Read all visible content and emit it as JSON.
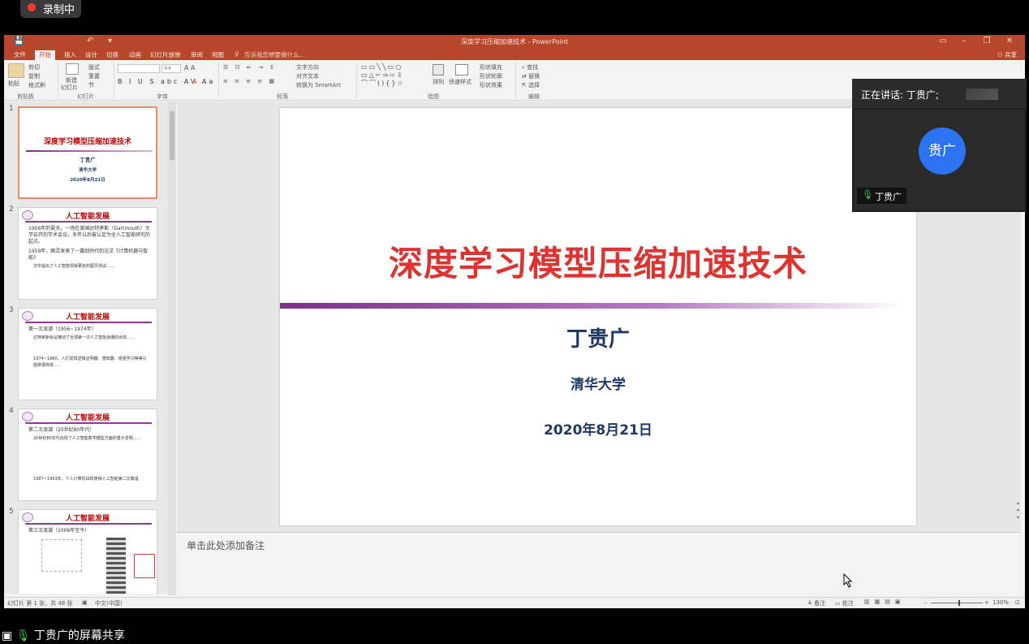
{
  "recording": {
    "label": "录制中"
  },
  "window": {
    "title": "深度学习压缩加速技术 - PowerPoint",
    "share": "共享",
    "tell_me": "告诉我您想要做什么..."
  },
  "tabs": [
    "文件",
    "开始",
    "插入",
    "设计",
    "切换",
    "动画",
    "幻灯片放映",
    "审阅",
    "视图"
  ],
  "ribbon": {
    "clipboard": {
      "paste": "粘贴",
      "cut": "剪切",
      "copy": "复制",
      "format_painter": "格式刷",
      "group": "剪贴板"
    },
    "slides": {
      "new_slide": "新建",
      "new_slide2": "幻灯片",
      "layout": "版式",
      "reset": "重置",
      "section": "节",
      "group": "幻灯片"
    },
    "font": {
      "size": "44",
      "group": "字体"
    },
    "paragraph": {
      "text_direction": "文字方向",
      "align_text": "对齐文本",
      "smartart": "转换为 SmartArt",
      "group": "段落"
    },
    "drawing": {
      "arrange": "排列",
      "quick_styles": "快速样式",
      "fill": "形状填充",
      "outline": "形状轮廓",
      "effects": "形状效果",
      "group": "绘图"
    },
    "editing": {
      "find": "查找",
      "replace": "替换",
      "select": "选择",
      "group": "编辑"
    }
  },
  "thumbnails": [
    {
      "num": "1",
      "title": "深度学习模型压缩加速技术",
      "author": "丁贵广",
      "inst": "清华大学",
      "date": "2020年8月21日"
    },
    {
      "num": "2",
      "title": "人工智能发展",
      "lines": [
        "1956年的夏天，一场在美国达特茅斯（Dartmouth）大学召开的学术会议，多年以后被认定为全人工智能研究的起点。",
        "1959年，图灵发表了一篇划时代的论文《计算机器与智能》",
        "文中提出了人工智能领域著名的图灵测试……"
      ]
    },
    {
      "num": "3",
      "title": "人工智能发展",
      "lines": [
        "第一次浪潮（1956~1974年）",
        "达特茅斯会议推动了全球第一次人工智能浪潮的出现……",
        "1974~1980，人们发现逻辑证明器、感知器、增强学习等等只能做很简单……"
      ]
    },
    {
      "num": "4",
      "title": "人工智能发展",
      "lines": [
        "第二次浪潮（20世纪80年代）",
        "20世纪80年代出现了人工智能数学模型方面的重大发明……",
        "1987~1993年，个人计算机出现使得人工智能第二次降温"
      ]
    },
    {
      "num": "5",
      "title": "人工智能发展",
      "lines": [
        "第三次浪潮（2006年至今）"
      ]
    }
  ],
  "slide": {
    "title": "深度学习模型压缩加速技术",
    "author": "丁贵广",
    "institution": "清华大学",
    "date": "2020年8月21日"
  },
  "notes_placeholder": "单击此处添加备注",
  "status": {
    "slide_info": "幻灯片 第 1 张，共 48 张",
    "language": "中文(中国)",
    "notes": "备注",
    "comments": "批注",
    "zoom": "130%"
  },
  "speaker": {
    "heading": "正在讲话: 丁贵广;",
    "avatar_text": "贵广",
    "name": "丁贵广"
  },
  "screen_share": {
    "label": "丁贵广的屏幕共享"
  },
  "colors": {
    "ppt_accent": "#b7472a",
    "title_red": "#e0322f",
    "navy": "#1f3864",
    "avatar_blue": "#2b73f1"
  }
}
